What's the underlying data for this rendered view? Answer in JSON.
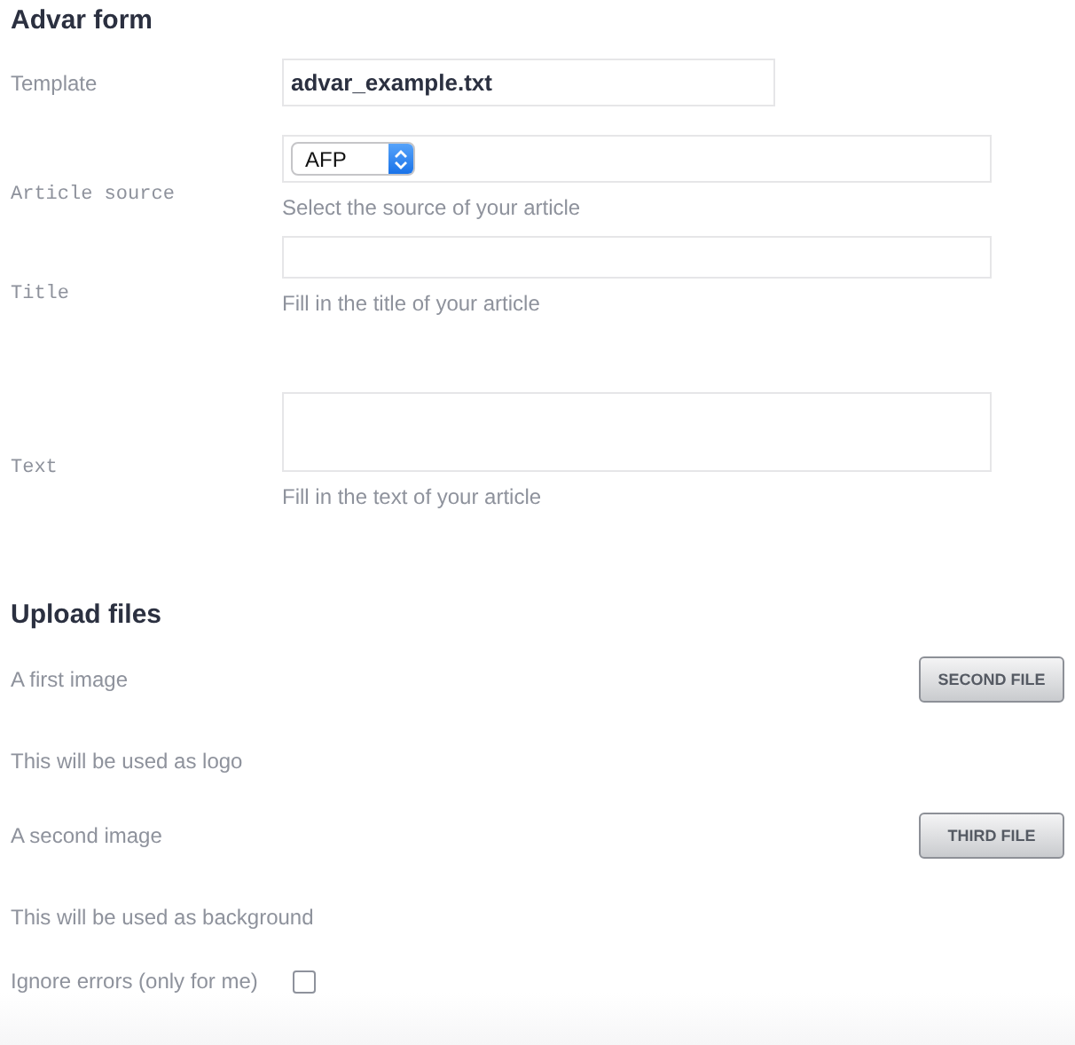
{
  "form": {
    "title": "Advar form",
    "fields": [
      {
        "label": "Template",
        "kind": "text",
        "value": "advar_example.txt"
      },
      {
        "label": "Article source",
        "kind": "select",
        "value": "AFP",
        "help": "Select the source of your article"
      },
      {
        "label": "Title",
        "kind": "text",
        "help": "Fill in the title of your article"
      },
      {
        "label": "Text",
        "kind": "textarea",
        "help": "Fill in the text of your article"
      }
    ]
  },
  "upload": {
    "title": "Upload files",
    "files": [
      {
        "label": "A first image",
        "button": "SECOND FILE",
        "note": "This will be used as logo"
      },
      {
        "label": "A second image",
        "button": "THIRD FILE",
        "note": "This will be used as background"
      }
    ],
    "ignore_errors": {
      "label": "Ignore errors (only for me)",
      "checked": false
    }
  }
}
